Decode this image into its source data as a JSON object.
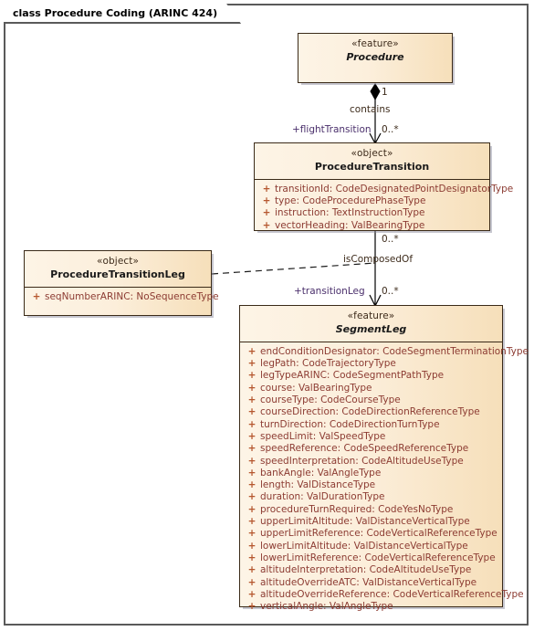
{
  "diagram": {
    "title": "class Procedure Coding (ARINC 424)"
  },
  "classes": {
    "procedure": {
      "stereotype": "«feature»",
      "name": "Procedure",
      "abstract": true,
      "attributes": []
    },
    "procedure_transition": {
      "stereotype": "«object»",
      "name": "ProcedureTransition",
      "abstract": false,
      "attributes": [
        {
          "visibility": "+",
          "text": "transitionId: CodeDesignatedPointDesignatorType"
        },
        {
          "visibility": "+",
          "text": "type: CodeProcedurePhaseType"
        },
        {
          "visibility": "+",
          "text": "instruction: TextInstructionType"
        },
        {
          "visibility": "+",
          "text": "vectorHeading: ValBearingType"
        }
      ]
    },
    "procedure_transition_leg": {
      "stereotype": "«object»",
      "name": "ProcedureTransitionLeg",
      "abstract": false,
      "attributes": [
        {
          "visibility": "+",
          "text": "seqNumberARINC: NoSequenceType"
        }
      ]
    },
    "segment_leg": {
      "stereotype": "«feature»",
      "name": "SegmentLeg",
      "abstract": true,
      "attributes": [
        {
          "visibility": "+",
          "text": "endConditionDesignator: CodeSegmentTerminationType"
        },
        {
          "visibility": "+",
          "text": "legPath: CodeTrajectoryType"
        },
        {
          "visibility": "+",
          "text": "legTypeARINC: CodeSegmentPathType"
        },
        {
          "visibility": "+",
          "text": "course: ValBearingType"
        },
        {
          "visibility": "+",
          "text": "courseType: CodeCourseType"
        },
        {
          "visibility": "+",
          "text": "courseDirection: CodeDirectionReferenceType"
        },
        {
          "visibility": "+",
          "text": "turnDirection: CodeDirectionTurnType"
        },
        {
          "visibility": "+",
          "text": "speedLimit: ValSpeedType"
        },
        {
          "visibility": "+",
          "text": "speedReference: CodeSpeedReferenceType"
        },
        {
          "visibility": "+",
          "text": "speedInterpretation: CodeAltitudeUseType"
        },
        {
          "visibility": "+",
          "text": "bankAngle: ValAngleType"
        },
        {
          "visibility": "+",
          "text": "length: ValDistanceType"
        },
        {
          "visibility": "+",
          "text": "duration: ValDurationType"
        },
        {
          "visibility": "+",
          "text": "procedureTurnRequired: CodeYesNoType"
        },
        {
          "visibility": "+",
          "text": "upperLimitAltitude: ValDistanceVerticalType"
        },
        {
          "visibility": "+",
          "text": "upperLimitReference: CodeVerticalReferenceType"
        },
        {
          "visibility": "+",
          "text": "lowerLimitAltitude: ValDistanceVerticalType"
        },
        {
          "visibility": "+",
          "text": "lowerLimitReference: CodeVerticalReferenceType"
        },
        {
          "visibility": "+",
          "text": "altitudeInterpretation: CodeAltitudeUseType"
        },
        {
          "visibility": "+",
          "text": "altitudeOverrideATC: ValDistanceVerticalType"
        },
        {
          "visibility": "+",
          "text": "altitudeOverrideReference: CodeVerticalReferenceType"
        },
        {
          "visibility": "+",
          "text": "verticalAngle: ValAngleType"
        }
      ]
    }
  },
  "connectors": {
    "contains": {
      "name": "contains",
      "source_multiplicity": "1",
      "target_role": "+flightTransition",
      "target_multiplicity": "0..*"
    },
    "is_composed_of": {
      "name": "isComposedOf",
      "source_multiplicity": "0..*",
      "target_role": "+transitionLeg",
      "target_multiplicity": "0..*"
    }
  },
  "colors": {
    "class_fill_light": "#fdf4e6",
    "class_fill_dark": "#f6dfba",
    "class_border": "#3a2a18",
    "attribute_text": "#8c3b32",
    "visibility_marker": "#b5562e",
    "role_text": "#4a2f6b",
    "frame_border": "#5a5a5a",
    "link_line": "#000000"
  }
}
